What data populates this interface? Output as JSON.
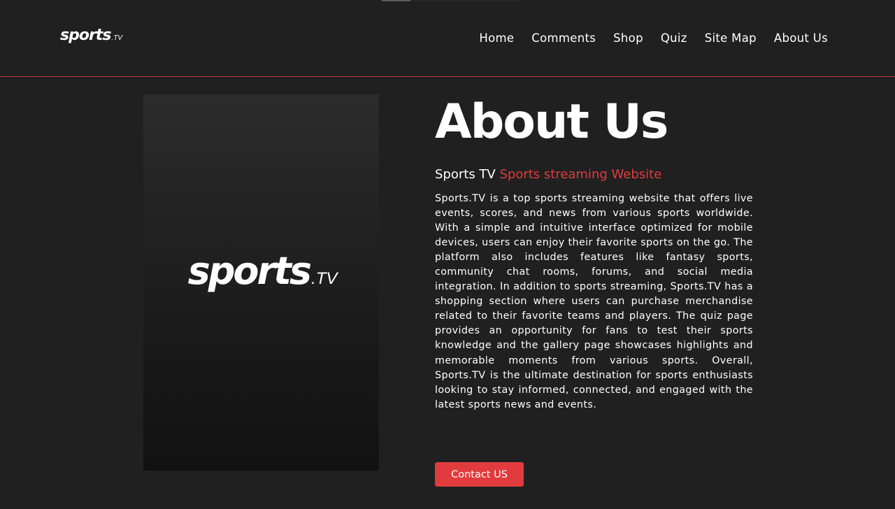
{
  "header": {
    "logo": {
      "main": "sports",
      "suffix": ".TV"
    },
    "nav": [
      {
        "label": "Home"
      },
      {
        "label": "Comments"
      },
      {
        "label": "Shop"
      },
      {
        "label": "Quiz"
      },
      {
        "label": "Site Map"
      },
      {
        "label": "About Us"
      }
    ]
  },
  "hero": {
    "logo": {
      "main": "sports",
      "suffix": ".TV"
    }
  },
  "about": {
    "title": "About Us",
    "subtitle_plain": "Sports TV",
    "subtitle_accent": "Sports streaming Website",
    "body": "Sports.TV is a top sports streaming website that offers live events, scores, and news from various sports worldwide. With a simple and intuitive interface optimized for mobile devices, users can enjoy their favorite sports on the go. The platform also includes features like fantasy sports, community chat rooms, forums, and social media integration. In addition to sports streaming, Sports.TV has a shopping section where users can purchase merchandise related to their favorite teams and players. The quiz page provides an opportunity for fans to test their sports knowledge and the gallery page showcases highlights and memorable moments from various sports. Overall, Sports.TV is the ultimate destination for sports enthusiasts looking to stay informed, connected, and engaged with the latest sports news and events.",
    "cta_label": "Contact US"
  },
  "colors": {
    "background": "#202021",
    "accent": "#e23b3d",
    "text": "#ffffff"
  }
}
